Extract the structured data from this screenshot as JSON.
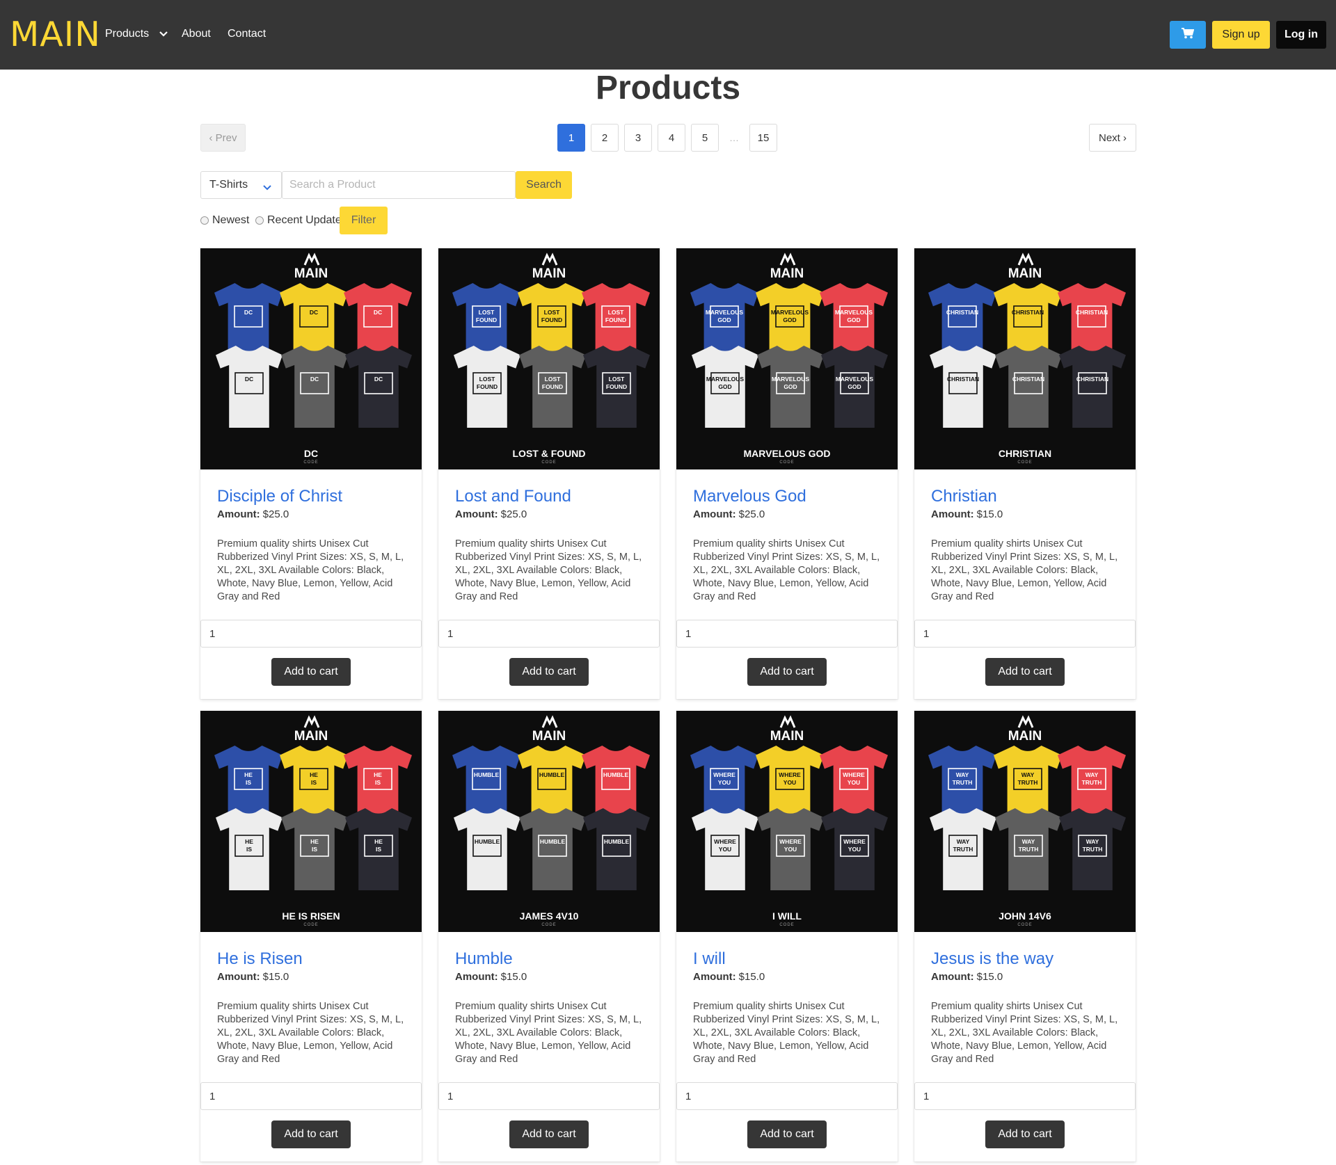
{
  "navbar": {
    "brand": "MAIN",
    "links": {
      "products": "Products",
      "about": "About",
      "contact": "Contact"
    },
    "cart_icon": "cart-icon",
    "signup": "Sign up",
    "login": "Log in",
    "colors": {
      "bg": "#363636",
      "brand": "#fdd835",
      "cart": "#2e9be8",
      "signup": "#fdd835",
      "login": "#0a0a0a"
    }
  },
  "page": {
    "title": "Products"
  },
  "pagination": {
    "prev": "‹ Prev",
    "next": "Next ›",
    "pages": [
      "1",
      "2",
      "3",
      "4",
      "5",
      "15"
    ],
    "ellipsis": "…",
    "current": "1"
  },
  "search": {
    "category": "T-Shirts",
    "placeholder": "Search a Product",
    "value": "",
    "button": "Search"
  },
  "filters": {
    "newest": "Newest",
    "recent_update": "Recent Update",
    "button": "Filter"
  },
  "products": [
    {
      "title": "Disciple of Christ",
      "amount_label": "Amount:",
      "amount": "$25.0",
      "description": "Premium quality shirts Unisex Cut Rubberized Vinyl Print Sizes: XS, S, M, L, XL, 2XL, 3XL Available Colors: Black, Whote, Navy Blue, Lemon, Yellow, Acid Gray and Red",
      "quantity": "1",
      "add_to_cart": "Add to cart",
      "image": {
        "brand": "MAIN",
        "shirt_print": "DC",
        "caption": "DC",
        "sub": "CODE"
      }
    },
    {
      "title": "Lost and Found",
      "amount_label": "Amount:",
      "amount": "$25.0",
      "description": "Premium quality shirts Unisex Cut Rubberized Vinyl Print Sizes: XS, S, M, L, XL, 2XL, 3XL Available Colors: Black, Whote, Navy Blue, Lemon, Yellow, Acid Gray and Red",
      "quantity": "1",
      "add_to_cart": "Add to cart",
      "image": {
        "brand": "MAIN",
        "shirt_print": "LOST FOUND",
        "caption": "LOST & FOUND",
        "sub": "CODE"
      }
    },
    {
      "title": "Marvelous God",
      "amount_label": "Amount:",
      "amount": "$25.0",
      "description": "Premium quality shirts Unisex Cut Rubberized Vinyl Print Sizes: XS, S, M, L, XL, 2XL, 3XL Available Colors: Black, Whote, Navy Blue, Lemon, Yellow, Acid Gray and Red",
      "quantity": "1",
      "add_to_cart": "Add to cart",
      "image": {
        "brand": "MAIN",
        "shirt_print": "MARVELOUS GOD",
        "caption": "MARVELOUS GOD",
        "sub": "CODE"
      }
    },
    {
      "title": "Christian",
      "amount_label": "Amount:",
      "amount": "$15.0",
      "description": "Premium quality shirts Unisex Cut Rubberized Vinyl Print Sizes: XS, S, M, L, XL, 2XL, 3XL Available Colors: Black, Whote, Navy Blue, Lemon, Yellow, Acid Gray and Red",
      "quantity": "1",
      "add_to_cart": "Add to cart",
      "image": {
        "brand": "MAIN",
        "shirt_print": "CHRISTIAN",
        "caption": "CHRISTIAN",
        "sub": "CODE"
      }
    },
    {
      "title": "He is Risen",
      "amount_label": "Amount:",
      "amount": "$15.0",
      "description": "Premium quality shirts Unisex Cut Rubberized Vinyl Print Sizes: XS, S, M, L, XL, 2XL, 3XL Available Colors: Black, Whote, Navy Blue, Lemon, Yellow, Acid Gray and Red",
      "quantity": "1",
      "add_to_cart": "Add to cart",
      "image": {
        "brand": "MAIN",
        "shirt_print": "He is risen",
        "caption": "HE IS RISEN",
        "sub": "CODE"
      }
    },
    {
      "title": "Humble",
      "amount_label": "Amount:",
      "amount": "$15.0",
      "description": "Premium quality shirts Unisex Cut Rubberized Vinyl Print Sizes: XS, S, M, L, XL, 2XL, 3XL Available Colors: Black, Whote, Navy Blue, Lemon, Yellow, Acid Gray and Red",
      "quantity": "1",
      "add_to_cart": "Add to cart",
      "image": {
        "brand": "MAIN",
        "shirt_print": "HUMBLE",
        "caption": "JAMES 4V10",
        "sub": "CODE"
      }
    },
    {
      "title": "I will",
      "amount_label": "Amount:",
      "amount": "$15.0",
      "description": "Premium quality shirts Unisex Cut Rubberized Vinyl Print Sizes: XS, S, M, L, XL, 2XL, 3XL Available Colors: Black, Whote, Navy Blue, Lemon, Yellow, Acid Gray and Red",
      "quantity": "1",
      "add_to_cart": "Add to cart",
      "image": {
        "brand": "MAIN",
        "shirt_print": "WHERE YOU GO",
        "caption": "I WILL",
        "sub": "CODE"
      }
    },
    {
      "title": "Jesus is the way",
      "amount_label": "Amount:",
      "amount": "$15.0",
      "description": "Premium quality shirts Unisex Cut Rubberized Vinyl Print Sizes: XS, S, M, L, XL, 2XL, 3XL Available Colors: Black, Whote, Navy Blue, Lemon, Yellow, Acid Gray and Red",
      "quantity": "1",
      "add_to_cart": "Add to cart",
      "image": {
        "brand": "MAIN",
        "shirt_print": "WAY TRUTH LIFE",
        "caption": "JOHN 14V6",
        "sub": "CODE"
      }
    }
  ],
  "shirt_colors": [
    "#2d4fa8",
    "#f3cf28",
    "#e8444c",
    "#ededed",
    "#5e5e5e",
    "#2a2a33"
  ],
  "colors": {
    "title_blue": "#2f6fdd",
    "accent_yellow": "#fdd835",
    "dark_button": "#363636"
  }
}
